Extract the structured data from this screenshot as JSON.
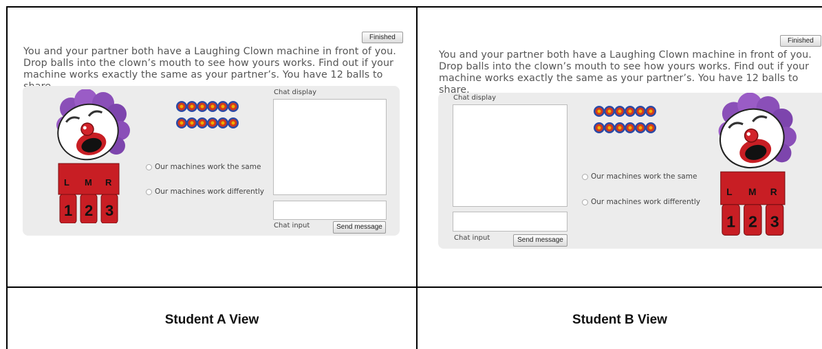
{
  "views": [
    {
      "caption": "Student A View",
      "finished_label": "Finished",
      "prompt": "You and your partner both have a Laughing Clown machine in front of you. Drop balls into the clown’s mouth to see how yours works. Find out if your machine works exactly the same as your partner’s. You have 12 balls to share.",
      "chat_display_label": "Chat display",
      "chat_input_label": "Chat input",
      "send_label": "Send message",
      "option_same": "Our machines work the same",
      "option_diff": "Our machines work differently",
      "column_letters": [
        "L",
        "M",
        "R"
      ],
      "column_numbers": [
        "1",
        "2",
        "3"
      ]
    },
    {
      "caption": "Student B View",
      "finished_label": "Finished",
      "prompt": "You and your partner both have a Laughing Clown machine in front of you. Drop balls into the clown’s mouth to see how yours works. Find out if your machine works exactly the same as your partner’s. You have 12 balls to share.",
      "chat_display_label": "Chat display",
      "chat_input_label": "Chat input",
      "send_label": "Send message",
      "option_same": "Our machines work the same",
      "option_diff": "Our machines work differently",
      "column_letters": [
        "L",
        "M",
        "R"
      ],
      "column_numbers": [
        "1",
        "2",
        "3"
      ]
    }
  ],
  "ball_rows": 2,
  "balls_per_row": 6,
  "colors": {
    "panel_bg": "#ececec",
    "prompt_text": "#555555",
    "clown_hair": "#8a4fb8",
    "clown_body": "#c81e24",
    "ball_blue": "#2a4aa8",
    "ball_red": "#d23a1e",
    "ball_yellow": "#f0b000"
  }
}
